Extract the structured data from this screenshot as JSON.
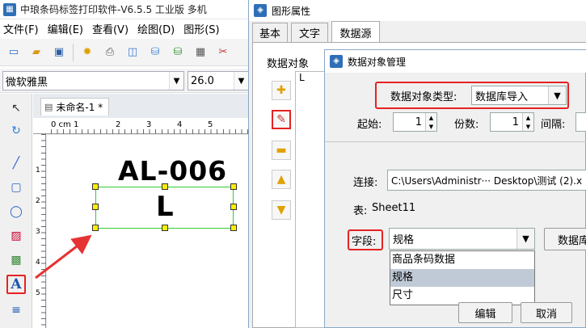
{
  "app": {
    "title": "中琅条码标签打印软件-V6.5.5 工业版 多机",
    "menus": [
      "文件(F)",
      "编辑(E)",
      "查看(V)",
      "绘图(D)",
      "图形(S)"
    ],
    "font_name": "微软雅黑",
    "font_size": "26.0",
    "doc_tab": "未命名-1 *",
    "ruler_label": "0 cm 1",
    "ruler_digits": [
      "2",
      "3",
      "4",
      "5"
    ],
    "vruler_digits": [
      "1",
      "2",
      "3",
      "4",
      "5"
    ],
    "label_text1": "AL-006",
    "label_text2": "L"
  },
  "props_dialog": {
    "title": "图形属性",
    "tabs": [
      "基本",
      "文字",
      "数据源"
    ],
    "active_tab": "数据源",
    "obj_label": "数据对象",
    "list_item": "L"
  },
  "dom_dialog": {
    "title": "数据对象管理",
    "type_label": "数据对象类型:",
    "type_value": "数据库导入",
    "start_label": "起始:",
    "start_value": "1",
    "copies_label": "份数:",
    "copies_value": "1",
    "interval_label": "间隔:",
    "conn_label": "连接:",
    "conn_value": "C:\\Users\\Administr··· Desktop\\测试 (2).x",
    "table_label": "表:",
    "table_value": "Sheet11",
    "field_label": "字段:",
    "field_value": "规格",
    "field_options": [
      "商品条码数据",
      "规格",
      "尺寸"
    ],
    "field_selected": "规格",
    "db_button": "数据库",
    "edit_button": "编辑",
    "cancel_button": "取消"
  },
  "colors": {
    "highlight_red": "#e52222",
    "selection_green": "#33cc33",
    "handle_yellow": "#ffee00",
    "list_selected": "#c0cad6"
  }
}
